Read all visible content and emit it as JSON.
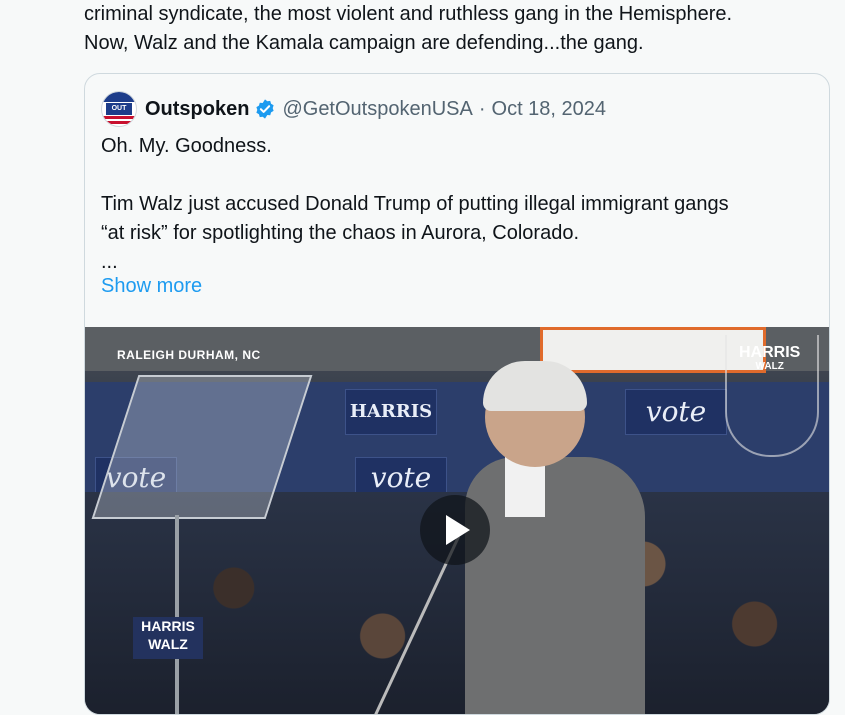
{
  "tweet": {
    "text_lines": [
      "criminal syndicate, the most violent and ruthless gang in the Hemisphere.",
      "Now, Walz and the Kamala campaign are defending...the gang."
    ]
  },
  "quoted": {
    "name": "Outspoken",
    "handle": "@GetOutspokenUSA",
    "separator": "·",
    "date": "Oct 18, 2024",
    "avatar_text": "OUT",
    "body_lines": [
      "Oh. My. Goodness.",
      "",
      "Tim Walz just accused Donald Trump of putting illegal immigrant gangs",
      "“at risk” for spotlighting the chaos in Aurora, Colorado.",
      "..."
    ],
    "show_more": "Show more",
    "verified_color": "#1d9bf0"
  },
  "video": {
    "location": "RALEIGH DURHAM, NC",
    "logo_top": "HARRIS",
    "logo_bottom": "WALZ",
    "panel_texts": [
      "HARRIS",
      "vote",
      "vote",
      "vote"
    ],
    "sign_top": "HARRIS",
    "sign_bottom": "WALZ",
    "play_icon": "play-icon"
  }
}
